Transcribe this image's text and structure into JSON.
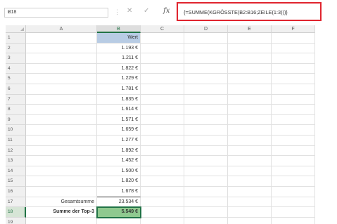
{
  "namebox": {
    "value": "B18",
    "dropdown": "▾"
  },
  "formula_bar": {
    "separator": "⋮",
    "cancel": "✕",
    "enter": "✓",
    "fx": "fx",
    "formula": "{=SUMME(KGRÖSSTE(B2:B16;ZEILE(1:3)))}"
  },
  "columns": [
    "A",
    "B",
    "C",
    "D",
    "E",
    "F"
  ],
  "rows": [
    {
      "n": "1",
      "a": "",
      "b": "Wert"
    },
    {
      "n": "2",
      "a": "",
      "b": "1.193 €"
    },
    {
      "n": "3",
      "a": "",
      "b": "1.211 €"
    },
    {
      "n": "4",
      "a": "",
      "b": "1.822 €"
    },
    {
      "n": "5",
      "a": "",
      "b": "1.229 €"
    },
    {
      "n": "6",
      "a": "",
      "b": "1.781 €"
    },
    {
      "n": "7",
      "a": "",
      "b": "1.835 €"
    },
    {
      "n": "8",
      "a": "",
      "b": "1.614 €"
    },
    {
      "n": "9",
      "a": "",
      "b": "1.571 €"
    },
    {
      "n": "10",
      "a": "",
      "b": "1.659 €"
    },
    {
      "n": "11",
      "a": "",
      "b": "1.277 €"
    },
    {
      "n": "12",
      "a": "",
      "b": "1.892 €"
    },
    {
      "n": "13",
      "a": "",
      "b": "1.452 €"
    },
    {
      "n": "14",
      "a": "",
      "b": "1.500 €"
    },
    {
      "n": "15",
      "a": "",
      "b": "1.820 €"
    },
    {
      "n": "16",
      "a": "",
      "b": "1.678 €"
    },
    {
      "n": "17",
      "a": "Gesamtsumme",
      "b": "23.534 €"
    },
    {
      "n": "18",
      "a": "Summe der Top-3",
      "b": "5.549 €"
    },
    {
      "n": "19",
      "a": "",
      "b": ""
    }
  ],
  "colors": {
    "header_fill": "#b8cce4",
    "result_fill": "#8fc98f",
    "accent": "#217346",
    "formula_border": "#e0242e"
  }
}
